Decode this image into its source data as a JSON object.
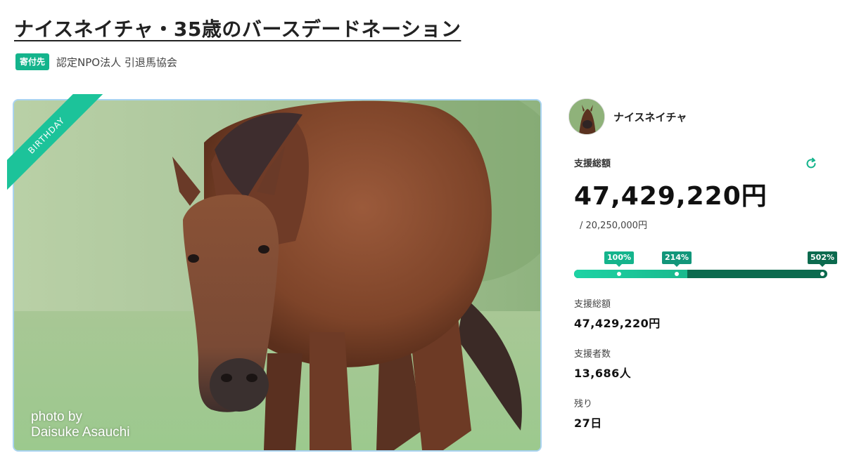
{
  "page": {
    "title": "ナイスネイチャ・35歳のバースデードネーション",
    "recipient_badge": "寄付先",
    "recipient_name": "認定NPO法人 引退馬協会"
  },
  "hero": {
    "ribbon_text": "BIRTHDAY",
    "credit_line1": "photo by",
    "credit_line2": "Daisuke Asauchi"
  },
  "campaign": {
    "owner_name": "ナイスネイチャ",
    "total_label": "支援総額",
    "total_amount": "47,429,220円",
    "goal": "/ 20,250,000円",
    "progress_percent": 234.2,
    "milestones": [
      {
        "label": "100%",
        "value": 100,
        "color": "#14b48c"
      },
      {
        "label": "214%",
        "value": 214,
        "color": "#11967a"
      },
      {
        "label": "502%",
        "value": 502,
        "color": "#0b6a4e"
      }
    ],
    "stats": [
      {
        "label": "支援総額",
        "value": "47,429,220円"
      },
      {
        "label": "支援者数",
        "value": "13,686人"
      },
      {
        "label": "残り",
        "value": "27日"
      }
    ]
  },
  "colors": {
    "accent": "#14b48c",
    "progress_dark": "#0b6a4e",
    "image_border": "#a9d3f0"
  }
}
